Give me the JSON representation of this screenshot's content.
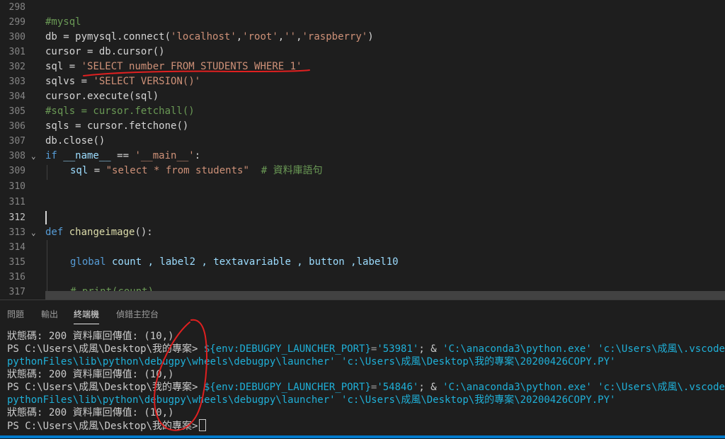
{
  "editor": {
    "lines": {
      "l298": {
        "num": "298"
      },
      "l299": {
        "num": "299",
        "t1": "#mysql"
      },
      "l300": {
        "num": "300",
        "t1": "db",
        "t2": " = pymysql.",
        "t3": "connect",
        "t4": "(",
        "t5": "'localhost'",
        "t6": ",",
        "t7": "'root'",
        "t8": ",",
        "t9": "''",
        "t10": ",",
        "t11": "'raspberry'",
        "t12": ")"
      },
      "l301": {
        "num": "301",
        "t1": "cursor",
        "t2": " = db.",
        "t3": "cursor",
        "t4": "()"
      },
      "l302": {
        "num": "302",
        "t1": "sql",
        "t2": " = ",
        "t3": "'SELECT number FROM STUDENTS WHERE 1'"
      },
      "l303": {
        "num": "303",
        "t1": "sqlvs",
        "t2": " = ",
        "t3": "'SELECT VERSION()'"
      },
      "l304": {
        "num": "304",
        "t1": "cursor.",
        "t2": "execute",
        "t3": "(sql)"
      },
      "l305": {
        "num": "305",
        "t1": "#sqls = cursor.fetchall()"
      },
      "l306": {
        "num": "306",
        "t1": "sqls",
        "t2": " = cursor.",
        "t3": "fetchone",
        "t4": "()"
      },
      "l307": {
        "num": "307",
        "t1": "db.",
        "t2": "close",
        "t3": "()"
      },
      "l308": {
        "num": "308",
        "t1": "if",
        "t2": " __name__",
        "t3": " == ",
        "t4": "'__main__'",
        "t5": ":"
      },
      "l309": {
        "num": "309",
        "t1": "sql",
        "t2": " = ",
        "t3": "\"select * from students\"",
        "t4": "  # 資料庫語句"
      },
      "l310": {
        "num": "310"
      },
      "l311": {
        "num": "311"
      },
      "l312": {
        "num": "312"
      },
      "l313": {
        "num": "313",
        "t1": "def",
        "t2": " ",
        "t3": "changeimage",
        "t4": "():"
      },
      "l314": {
        "num": "314"
      },
      "l315": {
        "num": "315",
        "t1": "global",
        "t2": " count , label2 , textavariable , button ,label10"
      },
      "l316": {
        "num": "316"
      },
      "l317": {
        "num": "317",
        "t1": "# print(count)"
      }
    },
    "fold_icon": "chevron-down-icon"
  },
  "panel": {
    "tabs": {
      "problems": "問題",
      "output": "輸出",
      "terminal": "終端機",
      "debug_console": "偵錯主控台"
    }
  },
  "terminal": {
    "r1": "狀態碼: 200 資料庫回傳值: (10,)",
    "r2a": "PS C:\\Users\\成風\\Desktop\\我的專案> ",
    "r2b": "${env:DEBUGPY_LAUNCHER_PORT}",
    "r2c": "=",
    "r2d": "'53981'",
    "r2e": "; & ",
    "r2f": "'C:\\anaconda3\\python.exe'",
    "r2g": " ",
    "r2h": "'c:\\Users\\成風\\.vscode\\e",
    "r3a": "pythonFiles\\lib\\python\\debugpy\\wheels\\debugpy\\launcher'",
    "r3b": " ",
    "r3c": "'c:\\Users\\成風\\Desktop\\我的專案\\20200426COPY.PY'",
    "r4": "狀態碼: 200 資料庫回傳值: (10,)",
    "r5a": "PS C:\\Users\\成風\\Desktop\\我的專案> ",
    "r5b": "${env:DEBUGPY_LAUNCHER_PORT}",
    "r5c": "=",
    "r5d": "'54846'",
    "r5e": "; & ",
    "r5f": "'C:\\anaconda3\\python.exe'",
    "r5g": " ",
    "r5h": "'c:\\Users\\成風\\.vscode\\e",
    "r6a": "pythonFiles\\lib\\python\\debugpy\\wheels\\debugpy\\launcher'",
    "r6b": " ",
    "r6c": "'c:\\Users\\成風\\Desktop\\我的專案\\20200426COPY.PY'",
    "r7": "狀態碼: 200 資料庫回傳值: (10,)",
    "r8": "PS C:\\Users\\成風\\Desktop\\我的專案>"
  },
  "colors": {
    "background": "#1e1e1e",
    "annotation": "#e02020",
    "accent": "#007acc"
  }
}
